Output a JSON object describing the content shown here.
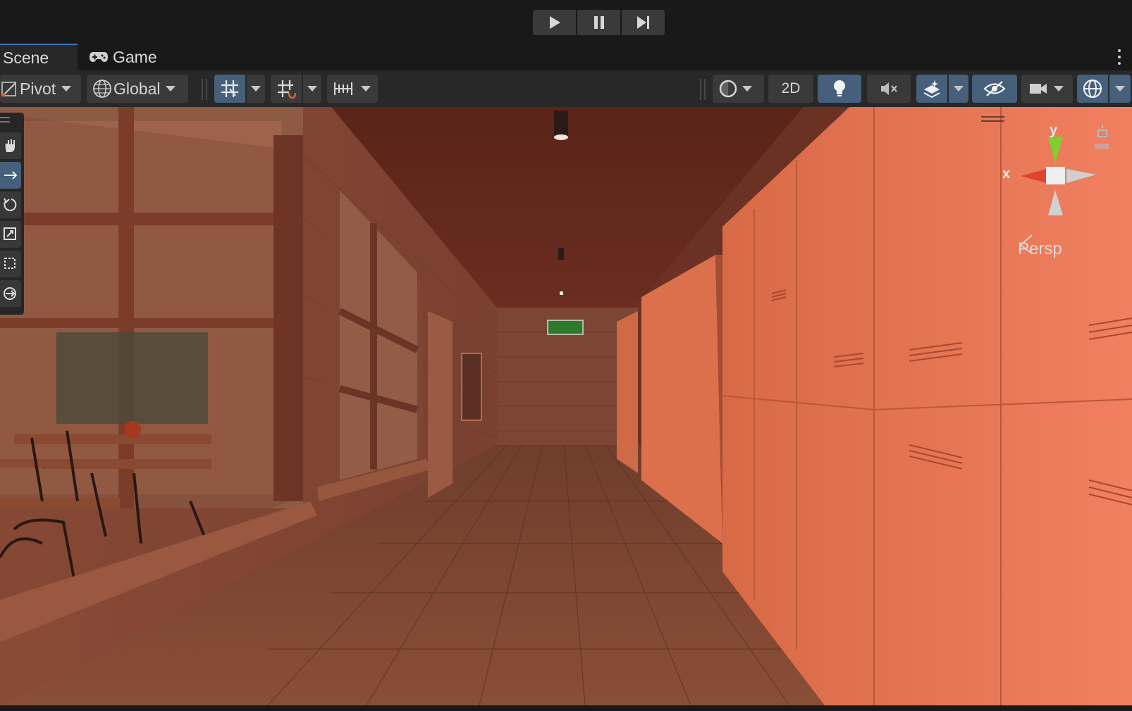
{
  "playmode": {
    "play": "play-icon",
    "pause": "pause-icon",
    "step": "step-icon"
  },
  "tabs": [
    {
      "label": "Scene",
      "icon": "none"
    },
    {
      "label": "Game",
      "icon": "gamepad-icon"
    }
  ],
  "toolbar": {
    "pivot_label": "Pivot",
    "global_label": "Global",
    "mode_2d_label": "2D"
  },
  "gizmo": {
    "y_label": "y",
    "x_label": "x",
    "projection_label": "Persp"
  },
  "colors": {
    "accent_active": "#46607c",
    "scene_tint": "#e4704a",
    "gizmo_x": "#e0442c",
    "gizmo_y": "#7fcf2e"
  }
}
